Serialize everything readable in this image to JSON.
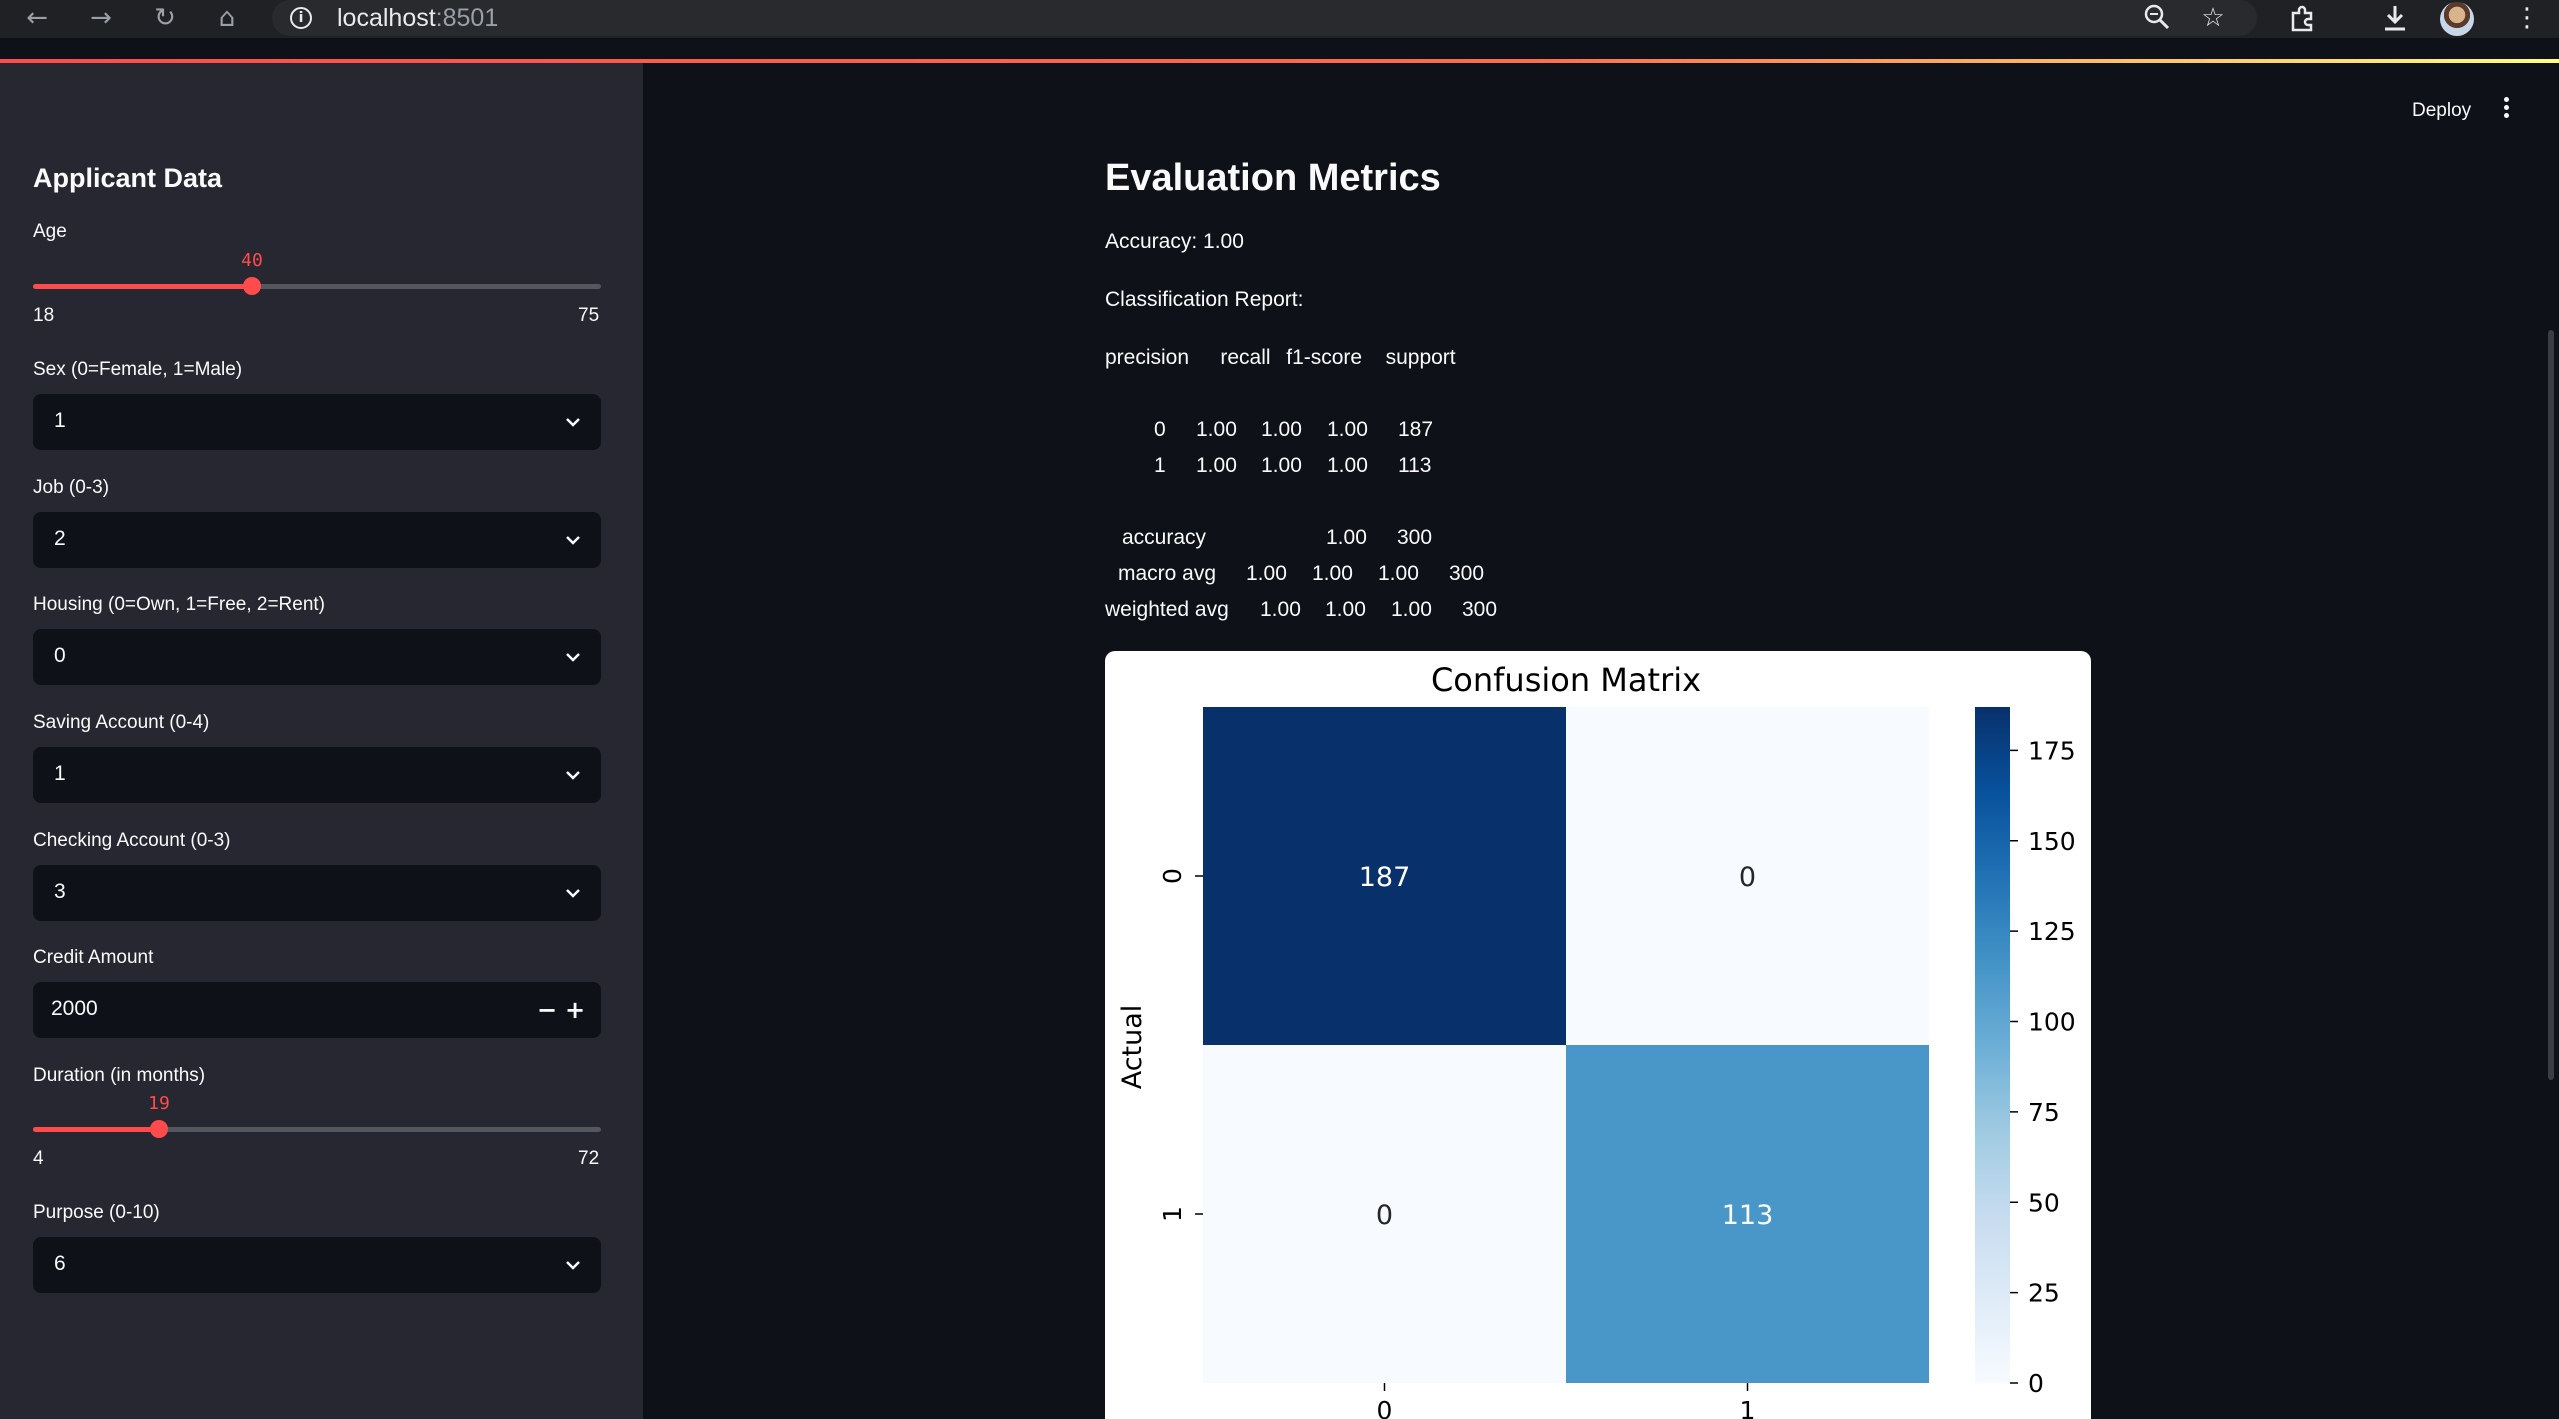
{
  "browser": {
    "url_host": "localhost",
    "url_port": ":8501"
  },
  "sidebar": {
    "title": "Applicant Data",
    "age": {
      "label": "Age",
      "value": "40",
      "min": "18",
      "max": "75",
      "fraction": 0.386
    },
    "sex": {
      "label": "Sex (0=Female, 1=Male)",
      "value": "1"
    },
    "job": {
      "label": "Job (0-3)",
      "value": "2"
    },
    "housing": {
      "label": "Housing (0=Own, 1=Free, 2=Rent)",
      "value": "0"
    },
    "saving": {
      "label": "Saving Account (0-4)",
      "value": "1"
    },
    "checking": {
      "label": "Checking Account (0-3)",
      "value": "3"
    },
    "credit": {
      "label": "Credit Amount",
      "value": "2000",
      "minus": "−",
      "plus": "+"
    },
    "duration": {
      "label": "Duration (in months)",
      "value": "19",
      "min": "4",
      "max": "72",
      "fraction": 0.221
    },
    "purpose": {
      "label": "Purpose (0-10)",
      "value": "6"
    }
  },
  "header": {
    "deploy": "Deploy"
  },
  "main": {
    "title": "Evaluation Metrics",
    "accuracy": "Accuracy: 1.00",
    "report_label": "Classification Report:",
    "report_header": "precision    recall  f1-score   support",
    "report_rows": [
      {
        "label": "0",
        "precision": "1.00",
        "recall": "1.00",
        "f1": "1.00",
        "support": "187"
      },
      {
        "label": "1",
        "precision": "1.00",
        "recall": "1.00",
        "f1": "1.00",
        "support": "113"
      }
    ],
    "accuracy_row": {
      "label": "accuracy",
      "f1": "1.00",
      "support": "300"
    },
    "macro_row": {
      "label": "macro avg",
      "precision": "1.00",
      "recall": "1.00",
      "f1": "1.00",
      "support": "300"
    },
    "weighted_row": {
      "label": "weighted avg",
      "precision": "1.00",
      "recall": "1.00",
      "f1": "1.00",
      "support": "300"
    }
  },
  "chart_data": {
    "type": "heatmap",
    "title": "Confusion Matrix",
    "ylabel": "Actual",
    "xlabel": "",
    "x_categories": [
      "0",
      "1"
    ],
    "y_categories": [
      "0",
      "1"
    ],
    "values": [
      [
        187,
        0
      ],
      [
        0,
        113
      ]
    ],
    "colormap": "Blues",
    "colorbar_range": [
      0,
      187
    ],
    "colorbar_ticks": [
      0,
      25,
      50,
      75,
      100,
      125,
      150,
      175
    ],
    "colors": {
      "low": "#f7fbff",
      "high": "#08306b"
    }
  }
}
